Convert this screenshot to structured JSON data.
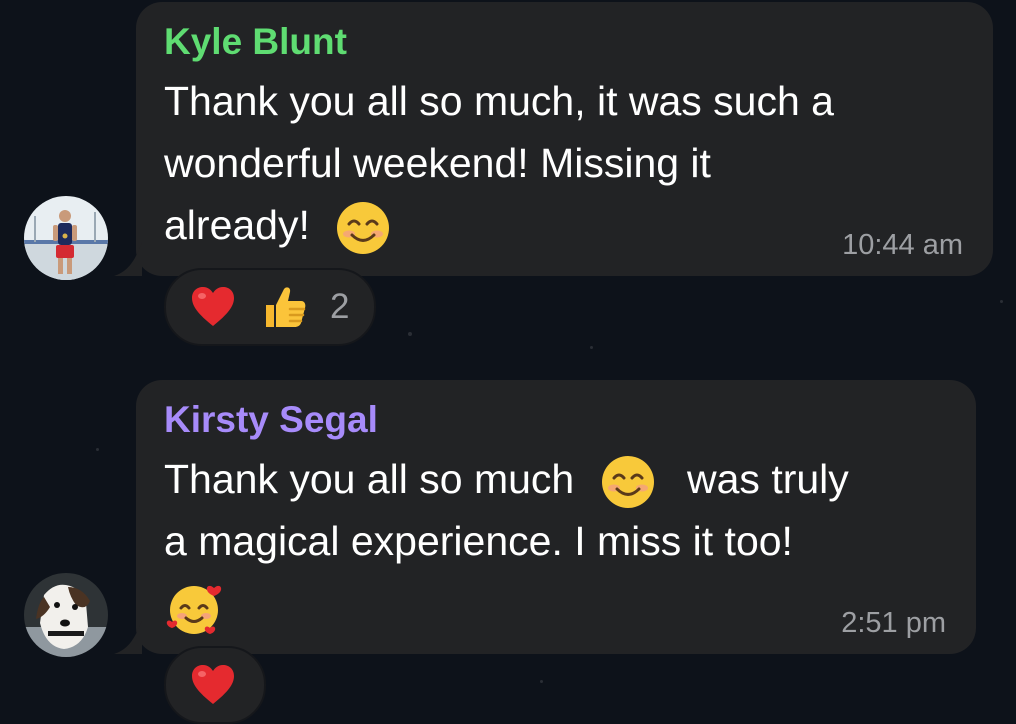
{
  "colors": {
    "background": "#0d121a",
    "bubble": "#222325",
    "kyle_name": "#5fdc72",
    "kirsty_name": "#a78bfa",
    "timestamp": "#9d9fa3"
  },
  "messages": [
    {
      "sender": "Kyle Blunt",
      "avatar": "avatar-photo-athlete",
      "lines": [
        "Thank you all so much, it was such a",
        "wonderful weekend! Missing it",
        "already!"
      ],
      "inline_emoji": "smiling-face-with-smiling-eyes",
      "time": "10:44 am",
      "reactions": [
        "red-heart",
        "thumbs-up"
      ],
      "reaction_count": "2"
    },
    {
      "sender": "Kirsty Segal",
      "avatar": "avatar-photo-dog",
      "line1_before": "Thank you all so much",
      "line1_after": "was truly",
      "line2": "a magical experience. I miss it too!",
      "emojis": [
        "smiling-face-with-smiling-eyes",
        "smiling-face-with-hearts"
      ],
      "time": "2:51 pm",
      "reactions": [
        "red-heart"
      ]
    }
  ]
}
